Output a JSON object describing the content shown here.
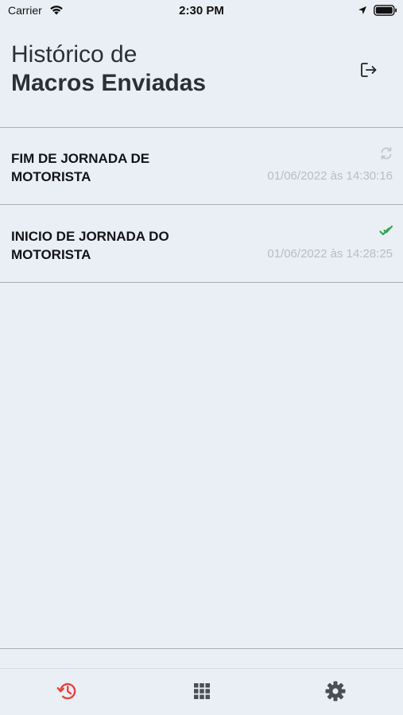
{
  "status_bar": {
    "carrier": "Carrier",
    "time": "2:30 PM",
    "icons": [
      "wifi-icon",
      "location-icon",
      "battery-icon"
    ]
  },
  "header": {
    "title_line1": "Histórico de",
    "title_line2": "Macros Enviadas",
    "action_icon": "logout-icon"
  },
  "macros": [
    {
      "title": "FIM DE JORNADA DE MOTORISTA",
      "timestamp": "01/06/2022 às 14:30:16",
      "status": "sync-icon",
      "status_color": "#c3c7cc"
    },
    {
      "title": "INICIO DE JORNADA DO MOTORISTA",
      "timestamp": "01/06/2022 às 14:28:25",
      "status": "double-check-icon",
      "status_color": "#2ea94e"
    }
  ],
  "tab_bar": {
    "tabs": [
      {
        "icon": "history-icon",
        "active": true
      },
      {
        "icon": "grid-icon",
        "active": false
      },
      {
        "icon": "gear-icon",
        "active": false
      }
    ],
    "active_color": "#e2453c",
    "inactive_color": "#4a4f57"
  }
}
